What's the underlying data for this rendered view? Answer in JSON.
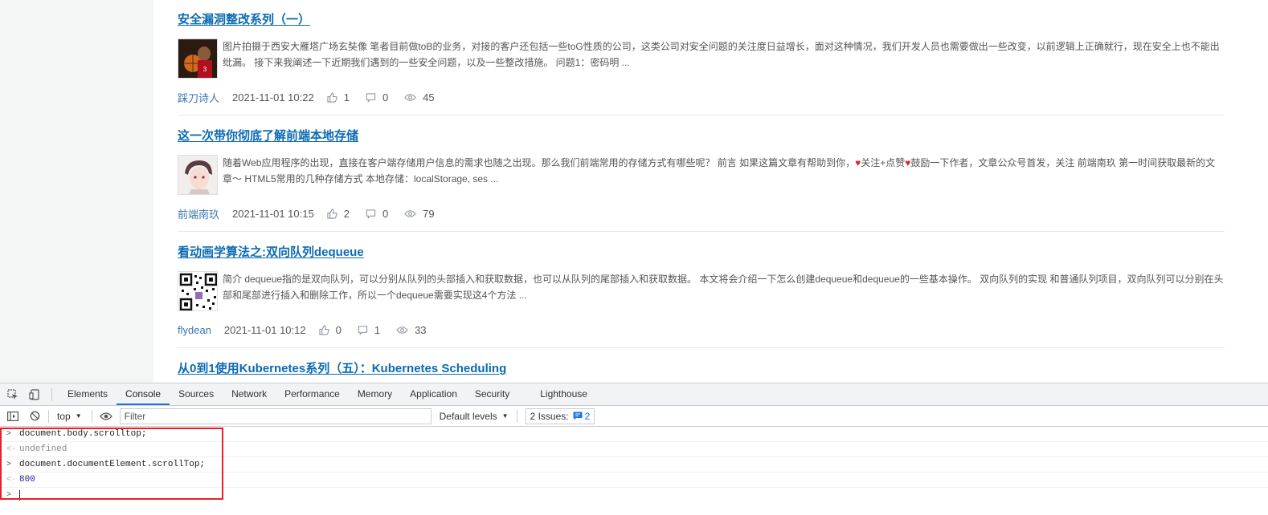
{
  "articles": [
    {
      "title": "安全漏洞整改系列（一）",
      "summary": "图片拍摄于西安大雁塔广场玄奘像 笔者目前做toB的业务，对接的客户还包括一些toG性质的公司，这类公司对安全问题的关注度日益增长，面对这种情况，我们开发人员也需要做出一些改变，以前逻辑上正确就行，现在安全上也不能出纰漏。 接下来我阐述一下近期我们遇到的一些安全问题，以及一些整改措施。 问题1：密码明 ...",
      "author": "踩刀诗人",
      "date": "2021-11-01 10:22",
      "likes": "1",
      "comments": "0",
      "views": "45",
      "thumb": "basketball-player"
    },
    {
      "title": "这一次带你彻底了解前端本地存储",
      "summary_parts": [
        "随着Web应用程序的出现，直接在客户端存储用户信息的需求也随之出现。那么我们前端常用的存储方式有哪些呢？ 前言 如果这篇文章有帮助到你，",
        "关注+点赞",
        "鼓励一下作者，文章公众号首发，关注 前端南玖 第一时间获取最新的文章～ HTML5常用的几种存储方式 本地存储：localStorage, ses ..."
      ],
      "author": "前端南玖",
      "date": "2021-11-01 10:15",
      "likes": "2",
      "comments": "0",
      "views": "79",
      "thumb": "anime-avatar"
    },
    {
      "title": "看动画学算法之:双向队列dequeue",
      "summary": "简介 dequeue指的是双向队列，可以分别从队列的头部插入和获取数据，也可以从队列的尾部插入和获取数据。 本文将会介绍一下怎么创建dequeue和dequeue的一些基本操作。 双向队列的实现 和普通队列项目，双向队列可以分别在头部和尾部进行插入和删除工作，所以一个dequeue需要实现这4个方法 ...",
      "author": "flydean",
      "date": "2021-11-01 10:12",
      "likes": "0",
      "comments": "1",
      "views": "33",
      "thumb": "qr-code"
    },
    {
      "title": "从0到1使用Kubernetes系列（五）：Kubernetes Scheduling"
    }
  ],
  "devtools": {
    "tabs": [
      "Elements",
      "Console",
      "Sources",
      "Network",
      "Performance",
      "Memory",
      "Application",
      "Security",
      "Lighthouse"
    ],
    "active_tab": "Console",
    "context": "top",
    "filter_placeholder": "Filter",
    "levels": "Default levels",
    "issues_label": "2 Issues:",
    "issues_count": "2",
    "console_lines": [
      {
        "kind": "input",
        "text": "document.body.scrolltop;"
      },
      {
        "kind": "result",
        "text": "undefined"
      },
      {
        "kind": "input",
        "text": "document.documentElement.scrollTop;"
      },
      {
        "kind": "result",
        "text": "800"
      }
    ],
    "prompt_symbol": ">",
    "result_symbol": "<·"
  },
  "colors": {
    "link": "#0b6ab3",
    "active_tab": "#1a73e8",
    "highlight_box": "#e8202a",
    "number_result": "#1a1aa6"
  }
}
